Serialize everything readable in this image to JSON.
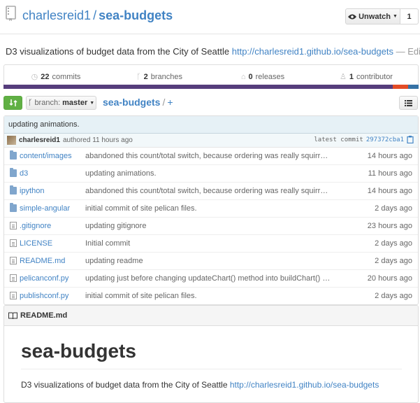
{
  "header": {
    "owner": "charlesreid1",
    "separator": "/",
    "repo": "sea-budgets",
    "unwatch_label": "Unwatch",
    "watch_count": "1"
  },
  "description": {
    "text": "D3 visualizations of budget data from the City of Seattle",
    "url": "http://charlesreid1.github.io/sea-budgets",
    "edit": "— Edit"
  },
  "summary": {
    "commits_count": "22",
    "commits_label": "commits",
    "branches_count": "2",
    "branches_label": "branches",
    "releases_count": "0",
    "releases_label": "releases",
    "contributors_count": "1",
    "contributors_label": "contributor"
  },
  "language_bar": [
    {
      "color": "#563d7c",
      "fraction": 0.938
    },
    {
      "color": "#e34c26",
      "fraction": 0.036
    },
    {
      "color": "#3572a5",
      "fraction": 0.026
    }
  ],
  "toolbar": {
    "branch_label": "branch:",
    "branch_value": "master",
    "crumb_repo": "sea-budgets",
    "crumb_sep": "/",
    "crumb_add": "+"
  },
  "commit": {
    "message": "updating animations.",
    "author": "charlesreid1",
    "authored": "authored 11 hours ago",
    "latest_label": "latest commit",
    "sha": "297372cba1"
  },
  "files": [
    {
      "type": "dir",
      "name": "content/images",
      "message": "abandoned this count/total switch, because ordering was really squirr…",
      "age": "14 hours ago"
    },
    {
      "type": "dir",
      "name": "d3",
      "message": "updating animations.",
      "age": "11 hours ago"
    },
    {
      "type": "dir",
      "name": "ipython",
      "message": "abandoned this count/total switch, because ordering was really squirr…",
      "age": "14 hours ago"
    },
    {
      "type": "dir",
      "name": "simple-angular",
      "message": "initial commit of site pelican files.",
      "age": "2 days ago"
    },
    {
      "type": "file",
      "name": ".gitignore",
      "message": "updating gitignore",
      "age": "23 hours ago"
    },
    {
      "type": "file",
      "name": "LICENSE",
      "message": "Initial commit",
      "age": "2 days ago"
    },
    {
      "type": "file",
      "name": "README.md",
      "message": "updating readme",
      "age": "2 days ago"
    },
    {
      "type": "file",
      "name": "pelicanconf.py",
      "message": "updating just before changing updateChart() method into buildChart() …",
      "age": "20 hours ago"
    },
    {
      "type": "file",
      "name": "publishconf.py",
      "message": "initial commit of site pelican files.",
      "age": "2 days ago"
    }
  ],
  "readme": {
    "filename": "README.md",
    "heading": "sea-budgets",
    "text": "D3 visualizations of budget data from the City of Seattle",
    "url": "http://charlesreid1.github.io/sea-budgets"
  }
}
